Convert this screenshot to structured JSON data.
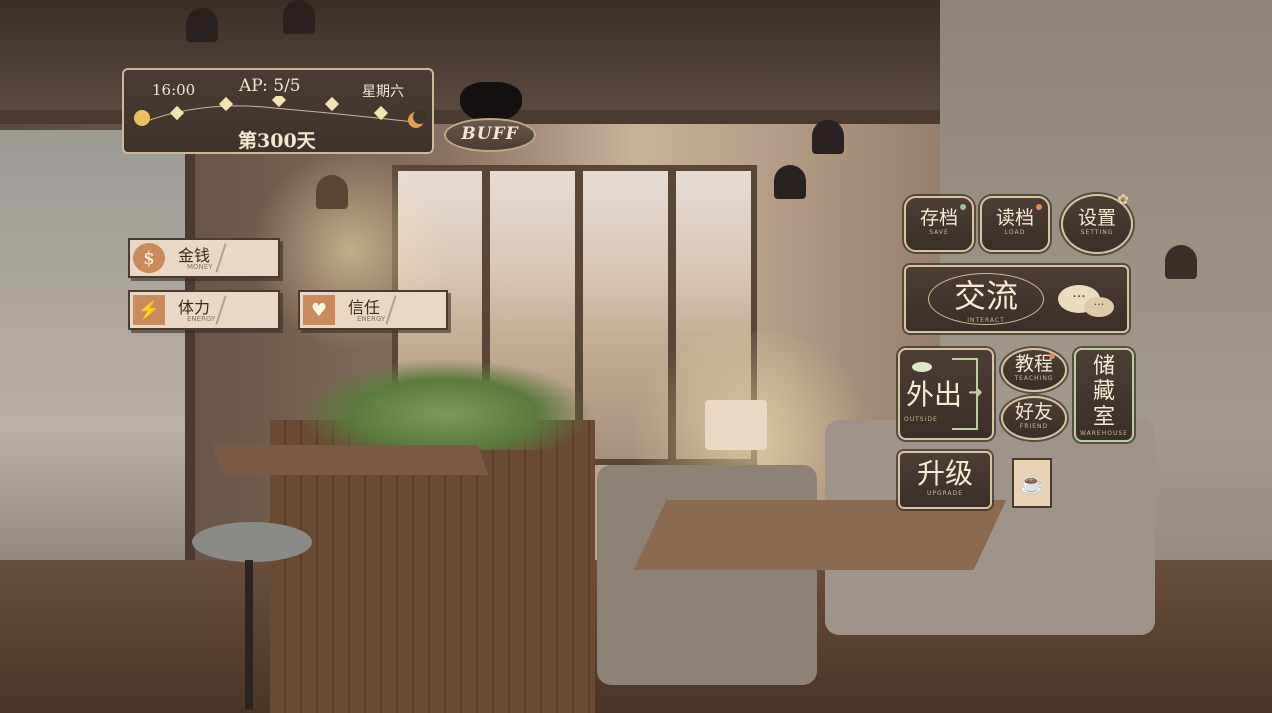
{
  "hud": {
    "time": "16:00",
    "ap_label": "AP:",
    "ap_value": "5/5",
    "weekday": "星期六",
    "day": "第300天",
    "buff_label": "BUFF"
  },
  "stats": {
    "money": {
      "label": "金钱",
      "sublabel": "MONEY",
      "icon": "coin-icon"
    },
    "energy": {
      "label": "体力",
      "sublabel": "ENERGY",
      "icon": "lightning-icon"
    },
    "trust": {
      "label": "信任",
      "sublabel": "ENERGY",
      "icon": "heart-icon"
    }
  },
  "menu": {
    "save": {
      "label": "存档",
      "sublabel": "SAVE"
    },
    "load": {
      "label": "读档",
      "sublabel": "LOAD"
    },
    "settings": {
      "label": "设置",
      "sublabel": "SETTING"
    },
    "interact": {
      "label": "交流",
      "sublabel": "INTERACT"
    },
    "outside": {
      "label": "外出",
      "sublabel": "OUTSIDE"
    },
    "teaching": {
      "label": "教程",
      "sublabel": "TEACHING"
    },
    "friend": {
      "label": "好友",
      "sublabel": "FRIEND"
    },
    "warehouse": {
      "label": "储藏室",
      "sublabel": "WAREHOUSE"
    },
    "upgrade": {
      "label": "升级",
      "sublabel": "UPGRADE"
    }
  },
  "colors": {
    "panel": "#3e322c",
    "border": "#d7c39e",
    "accent": "#c98a5e",
    "text": "#f6ead2"
  }
}
